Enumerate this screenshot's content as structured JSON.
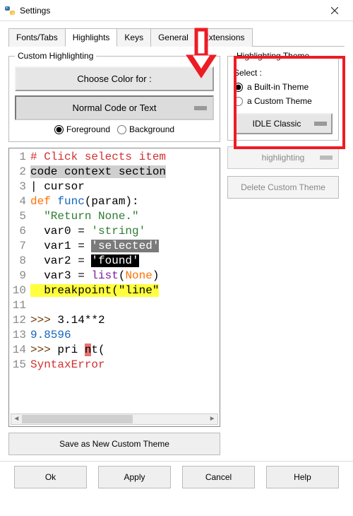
{
  "window": {
    "title": "Settings"
  },
  "tabs": {
    "items": [
      "Fonts/Tabs",
      "Highlights",
      "Keys",
      "General",
      "Extensions"
    ],
    "active_index": 1
  },
  "customHighlighting": {
    "legend": "Custom Highlighting",
    "chooseColor": "Choose Color for :",
    "normalText": "Normal Code or Text",
    "fgLabel": "Foreground",
    "bgLabel": "Background",
    "fgbgSelected": "fg"
  },
  "codeSample": {
    "lines": [
      {
        "n": 1,
        "segments": [
          {
            "t": "# Click selects item",
            "cls": "c-comment"
          }
        ]
      },
      {
        "n": 2,
        "segments": [
          {
            "t": "code context section",
            "cls": "bg-ctx"
          }
        ]
      },
      {
        "n": 3,
        "segments": [
          {
            "t": "| cursor"
          }
        ]
      },
      {
        "n": 4,
        "segments": [
          {
            "t": "def ",
            "cls": "c-kw"
          },
          {
            "t": "func",
            "cls": "c-def"
          },
          {
            "t": "(param):"
          }
        ]
      },
      {
        "n": 5,
        "segments": [
          {
            "t": "  "
          },
          {
            "t": "\"Return None.\"",
            "cls": "c-string"
          }
        ]
      },
      {
        "n": 6,
        "segments": [
          {
            "t": "  var0 = "
          },
          {
            "t": "'string'",
            "cls": "c-string"
          }
        ]
      },
      {
        "n": 7,
        "segments": [
          {
            "t": "  var1 = "
          },
          {
            "t": "'selected'",
            "cls": "bg-sel"
          }
        ]
      },
      {
        "n": 8,
        "segments": [
          {
            "t": "  var2 = "
          },
          {
            "t": "'found'",
            "cls": "bg-found"
          }
        ]
      },
      {
        "n": 9,
        "segments": [
          {
            "t": "  var3 = "
          },
          {
            "t": "list",
            "cls": "c-builtin"
          },
          {
            "t": "("
          },
          {
            "t": "None",
            "cls": "c-kw"
          },
          {
            "t": ")"
          }
        ]
      },
      {
        "n": 10,
        "segments": [
          {
            "t": "  breakpoint(\"line\"",
            "cls": "bg-bp"
          }
        ]
      },
      {
        "n": 11,
        "segments": [
          {
            "t": ""
          }
        ]
      },
      {
        "n": 12,
        "segments": [
          {
            "t": ">>> ",
            "cls": "c-prompt"
          },
          {
            "t": "3.14**2"
          }
        ]
      },
      {
        "n": 13,
        "segments": [
          {
            "t": "9.8596",
            "cls": "c-stdout"
          }
        ]
      },
      {
        "n": 14,
        "segments": [
          {
            "t": ">>> ",
            "cls": "c-prompt"
          },
          {
            "t": "pri "
          },
          {
            "t": "n",
            "cls": "bg-hit"
          },
          {
            "t": "t("
          }
        ]
      },
      {
        "n": 15,
        "segments": [
          {
            "t": "SyntaxError",
            "cls": "c-err"
          }
        ]
      }
    ]
  },
  "themePanel": {
    "legend": "Highlighting Theme",
    "selectLabel": "Select :",
    "builtinLabel": "a Built-in Theme",
    "customLabel": "a Custom Theme",
    "selected": "builtin",
    "dropdownValue": "IDLE Classic",
    "highlightingBtn": "highlighting",
    "deleteBtn": "Delete Custom Theme"
  },
  "saveLabel": "Save as New Custom Theme",
  "buttons": {
    "ok": "Ok",
    "apply": "Apply",
    "cancel": "Cancel",
    "help": "Help"
  }
}
